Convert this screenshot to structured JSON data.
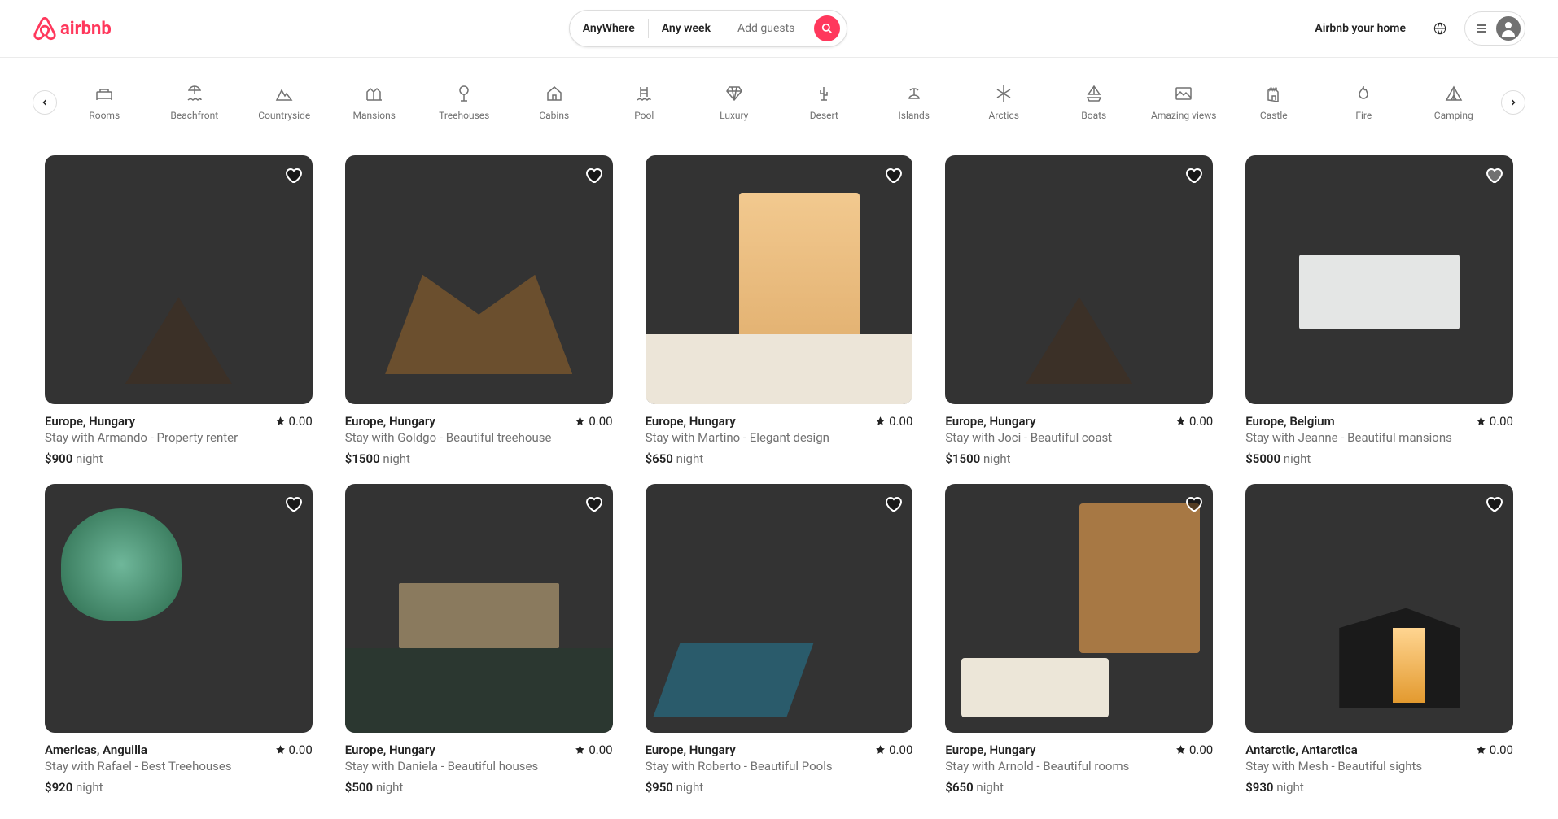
{
  "brand": "airbnb",
  "search": {
    "where": "AnyWhere",
    "week": "Any week",
    "guests": "Add guests"
  },
  "header": {
    "host": "Airbnb your home"
  },
  "categories": [
    {
      "label": "Rooms",
      "icon": "bed-icon"
    },
    {
      "label": "Beachfront",
      "icon": "beach-icon"
    },
    {
      "label": "Countryside",
      "icon": "mountain-icon"
    },
    {
      "label": "Mansions",
      "icon": "mansion-icon"
    },
    {
      "label": "Treehouses",
      "icon": "tree-icon"
    },
    {
      "label": "Cabins",
      "icon": "cabin-icon"
    },
    {
      "label": "Pool",
      "icon": "pool-icon"
    },
    {
      "label": "Luxury",
      "icon": "diamond-icon"
    },
    {
      "label": "Desert",
      "icon": "cactus-icon"
    },
    {
      "label": "Islands",
      "icon": "island-icon"
    },
    {
      "label": "Arctics",
      "icon": "snowflake-icon"
    },
    {
      "label": "Boats",
      "icon": "boat-icon"
    },
    {
      "label": "Amazing views",
      "icon": "frame-icon"
    },
    {
      "label": "Castle",
      "icon": "castle-icon"
    },
    {
      "label": "Fire",
      "icon": "fire-icon"
    },
    {
      "label": "Camping",
      "icon": "tent-icon"
    }
  ],
  "listings": [
    {
      "location": "Europe, Hungary",
      "desc": "Stay with Armando - Property renter",
      "price": "$900",
      "night": "night",
      "rating": "0.00",
      "bg": "bg0",
      "fav": false
    },
    {
      "location": "Europe, Hungary",
      "desc": "Stay with Goldgo - Beautiful treehouse",
      "price": "$1500",
      "night": "night",
      "rating": "0.00",
      "bg": "bg1",
      "fav": false
    },
    {
      "location": "Europe, Hungary",
      "desc": "Stay with Martino - Elegant design",
      "price": "$650",
      "night": "night",
      "rating": "0.00",
      "bg": "bg2",
      "fav": false
    },
    {
      "location": "Europe, Hungary",
      "desc": "Stay with Joci - Beautiful coast",
      "price": "$1500",
      "night": "night",
      "rating": "0.00",
      "bg": "bg3",
      "fav": false
    },
    {
      "location": "Europe, Belgium",
      "desc": "Stay with Jeanne - Beautiful mansions",
      "price": "$5000",
      "night": "night",
      "rating": "0.00",
      "bg": "bg4",
      "fav": true
    },
    {
      "location": "Americas, Anguilla",
      "desc": "Stay with Rafael - Best Treehouses",
      "price": "$920",
      "night": "night",
      "rating": "0.00",
      "bg": "bg5",
      "fav": false
    },
    {
      "location": "Europe, Hungary",
      "desc": "Stay with Daniela - Beautiful houses",
      "price": "$500",
      "night": "night",
      "rating": "0.00",
      "bg": "bg6",
      "fav": false
    },
    {
      "location": "Europe, Hungary",
      "desc": "Stay with Roberto - Beautiful Pools",
      "price": "$950",
      "night": "night",
      "rating": "0.00",
      "bg": "bg7",
      "fav": false
    },
    {
      "location": "Europe, Hungary",
      "desc": "Stay with Arnold - Beautiful rooms",
      "price": "$650",
      "night": "night",
      "rating": "0.00",
      "bg": "bg8",
      "fav": false
    },
    {
      "location": "Antarctic, Antarctica",
      "desc": "Stay with Mesh - Beautiful sights",
      "price": "$930",
      "night": "night",
      "rating": "0.00",
      "bg": "bg9",
      "fav": false
    }
  ]
}
